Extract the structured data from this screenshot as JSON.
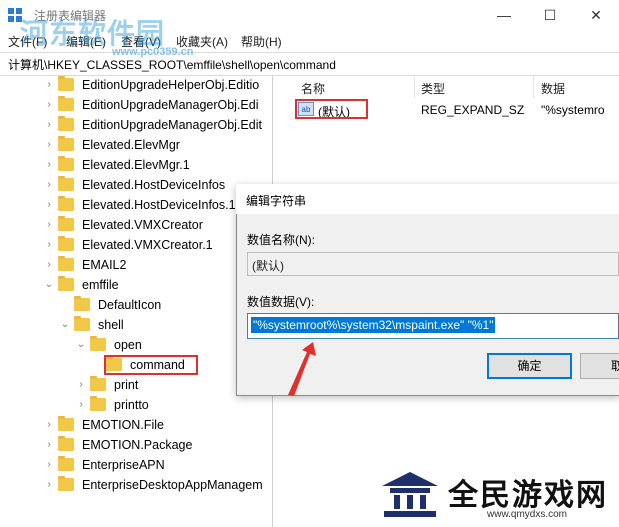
{
  "window": {
    "title": "注册表编辑器",
    "controls": {
      "minimize": "—",
      "maximize": "☐",
      "close": "✕"
    }
  },
  "menu": [
    "文件(F)",
    "编辑(E)",
    "查看(V)",
    "收藏夹(A)",
    "帮助(H)"
  ],
  "address": "计算机\\HKEY_CLASSES_ROOT\\emffile\\shell\\open\\command",
  "tree": [
    {
      "label": "EditionUpgradeHelperObj.Editio",
      "chevron": "›"
    },
    {
      "label": "EditionUpgradeManagerObj.Edi",
      "chevron": "›"
    },
    {
      "label": "EditionUpgradeManagerObj.Edit",
      "chevron": "›"
    },
    {
      "label": "Elevated.ElevMgr",
      "chevron": "›"
    },
    {
      "label": "Elevated.ElevMgr.1",
      "chevron": "›"
    },
    {
      "label": "Elevated.HostDeviceInfos",
      "chevron": "›"
    },
    {
      "label": "Elevated.HostDeviceInfos.1",
      "chevron": "›"
    },
    {
      "label": "Elevated.VMXCreator",
      "chevron": "›"
    },
    {
      "label": "Elevated.VMXCreator.1",
      "chevron": "›"
    },
    {
      "label": "EMAIL2",
      "chevron": "›"
    },
    {
      "label": "emffile",
      "chevron": "⌄"
    },
    {
      "label": "DefaultIcon",
      "chevron": ""
    },
    {
      "label": "shell",
      "chevron": "⌄"
    },
    {
      "label": "open",
      "chevron": "⌄"
    },
    {
      "label": "command",
      "chevron": ""
    },
    {
      "label": "print",
      "chevron": "›"
    },
    {
      "label": "printto",
      "chevron": "›"
    },
    {
      "label": "EMOTION.File",
      "chevron": "›"
    },
    {
      "label": "EMOTION.Package",
      "chevron": "›"
    },
    {
      "label": "EnterpriseAPN",
      "chevron": "›"
    },
    {
      "label": "EnterpriseDesktopAppManagem",
      "chevron": "›"
    }
  ],
  "list": {
    "headers": {
      "name": "名称",
      "type": "类型",
      "data": "数据"
    },
    "rows": [
      {
        "icon": "ab",
        "name": "(默认)",
        "type": "REG_EXPAND_SZ",
        "data": "\"%systemro"
      }
    ]
  },
  "dialog": {
    "title": "编辑字符串",
    "name_label": "数值名称(N):",
    "name_value": "(默认)",
    "data_label": "数值数据(V):",
    "data_value": "\"%systemroot%\\system32\\mspaint.exe\" \"%1\"",
    "ok_label": "确定",
    "cancel_label": "取"
  },
  "watermarks": {
    "top_text": "河东软件园",
    "top_url": "www.pc0359.cn",
    "brand": "全民游戏网",
    "brand_url": "www.qmydxs.com"
  },
  "colors": {
    "highlight_red": "#e0302e",
    "selection_blue": "#0078d7",
    "folder_yellow": "#f2c84b"
  }
}
